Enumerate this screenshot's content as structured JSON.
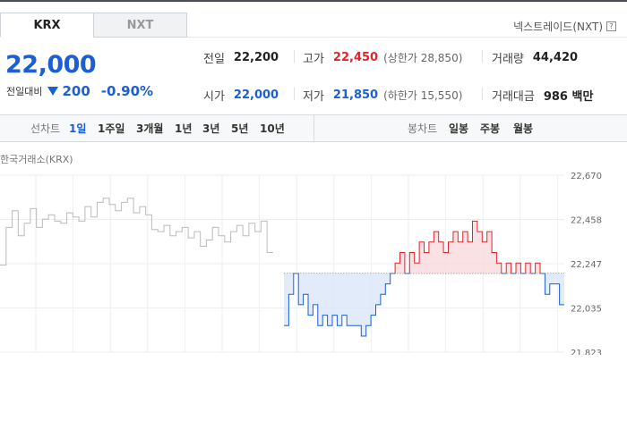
{
  "tabs": [
    {
      "label": "KRX",
      "active": true
    },
    {
      "label": "NXT",
      "active": false
    }
  ],
  "nxt_link": "넥스트레이드(NXT)",
  "price": {
    "current": "22,000",
    "change_label": "전일대비",
    "change_amount": "200",
    "change_percent": "-0.90%",
    "direction": "down",
    "color_down": "#1d5fd1",
    "color_up": "#e0242b"
  },
  "stats": {
    "prev_close": {
      "label": "전일",
      "value": "22,200"
    },
    "high": {
      "label": "고가",
      "value": "22,450",
      "sub": "(상한가 28,850)"
    },
    "volume": {
      "label": "거래량",
      "value": "44,420"
    },
    "open": {
      "label": "시가",
      "value": "22,000"
    },
    "low": {
      "label": "저가",
      "value": "21,850",
      "sub": "(하한가 15,550)"
    },
    "trade_value": {
      "label": "거래대금",
      "value": "986 백만"
    }
  },
  "controls": {
    "line_label": "선차트",
    "periods": [
      "1일",
      "1주일",
      "3개월",
      "1년",
      "3년",
      "5년",
      "10년"
    ],
    "active_period": "1일",
    "candle_label": "봉차트",
    "candles": [
      "일봉",
      "주봉",
      "월봉"
    ]
  },
  "chart_data": {
    "type": "line",
    "source_label": "한국거래소(KRX)",
    "y_ticks": [
      "22,670",
      "22,458",
      "22,247",
      "22,035",
      "21,823"
    ],
    "ylim": [
      21823,
      22670
    ],
    "baseline": 22200,
    "grid": true,
    "series": [
      {
        "segment": "previous session",
        "color": "#bbbbbb",
        "values": [
          22240,
          22420,
          22500,
          22380,
          22440,
          22510,
          22420,
          22460,
          22480,
          22450,
          22440,
          22490,
          22470,
          22450,
          22520,
          22470,
          22540,
          22560,
          22530,
          22500,
          22540,
          22560,
          22490,
          22520,
          22480,
          22410,
          22400,
          22430,
          22380,
          22400,
          22420,
          22370,
          22400,
          22330,
          22360,
          22420,
          22380,
          22350,
          22400,
          22430,
          22380,
          22440,
          22400,
          22450,
          22300
        ]
      },
      {
        "segment": "today",
        "up_color": "#e0242b",
        "down_color": "#1d5fd1",
        "values": [
          21950,
          22100,
          22200,
          22050,
          22100,
          22000,
          22050,
          21950,
          22000,
          21950,
          22000,
          21950,
          22000,
          21950,
          21950,
          21950,
          21900,
          21950,
          22000,
          22050,
          22100,
          22150,
          22200,
          22250,
          22300,
          22200,
          22300,
          22250,
          22350,
          22300,
          22350,
          22400,
          22350,
          22300,
          22350,
          22400,
          22350,
          22400,
          22350,
          22450,
          22400,
          22350,
          22400,
          22300,
          22250,
          22200,
          22250,
          22200,
          22250,
          22200,
          22250,
          22200,
          22250,
          22200,
          22100,
          22150,
          22150,
          22050
        ]
      }
    ]
  }
}
